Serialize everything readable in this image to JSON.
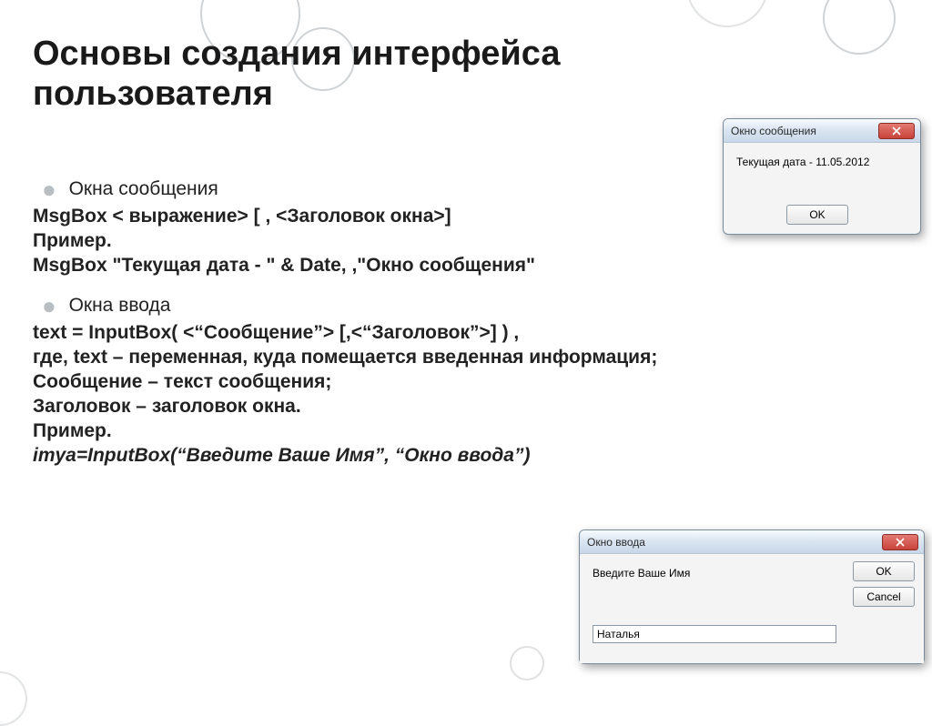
{
  "title_line1": "Основы создания интерфейса",
  "title_line2": "пользователя",
  "section1": {
    "heading": "Окна сообщения",
    "line1": "MsgBox < выражение> [ , <Заголовок окна>]",
    "line2": "Пример.",
    "line3": "MsgBox \"Текущая дата - \" & Date, ,\"Окно сообщения\""
  },
  "section2": {
    "heading": "Окна ввода",
    "line1": "text = InputBox( <“Сообщение”> [,<“Заголовок”>] ) ,",
    "line2": "где, text – переменная, куда помещается введенная информация;",
    "line3": "Сообщение – текст сообщения;",
    "line4": "Заголовок – заголовок окна.",
    "line5": "Пример.",
    "line6": "imya=InputBox(“Введите Ваше Имя”, “Окно ввода”)"
  },
  "msgbox": {
    "title": "Окно сообщения",
    "text": "Текущая дата - 11.05.2012",
    "ok": "OK"
  },
  "inputbox": {
    "title": "Окно ввода",
    "prompt": "Введите Ваше Имя",
    "ok": "OK",
    "cancel": "Cancel",
    "value": "Наталья"
  }
}
